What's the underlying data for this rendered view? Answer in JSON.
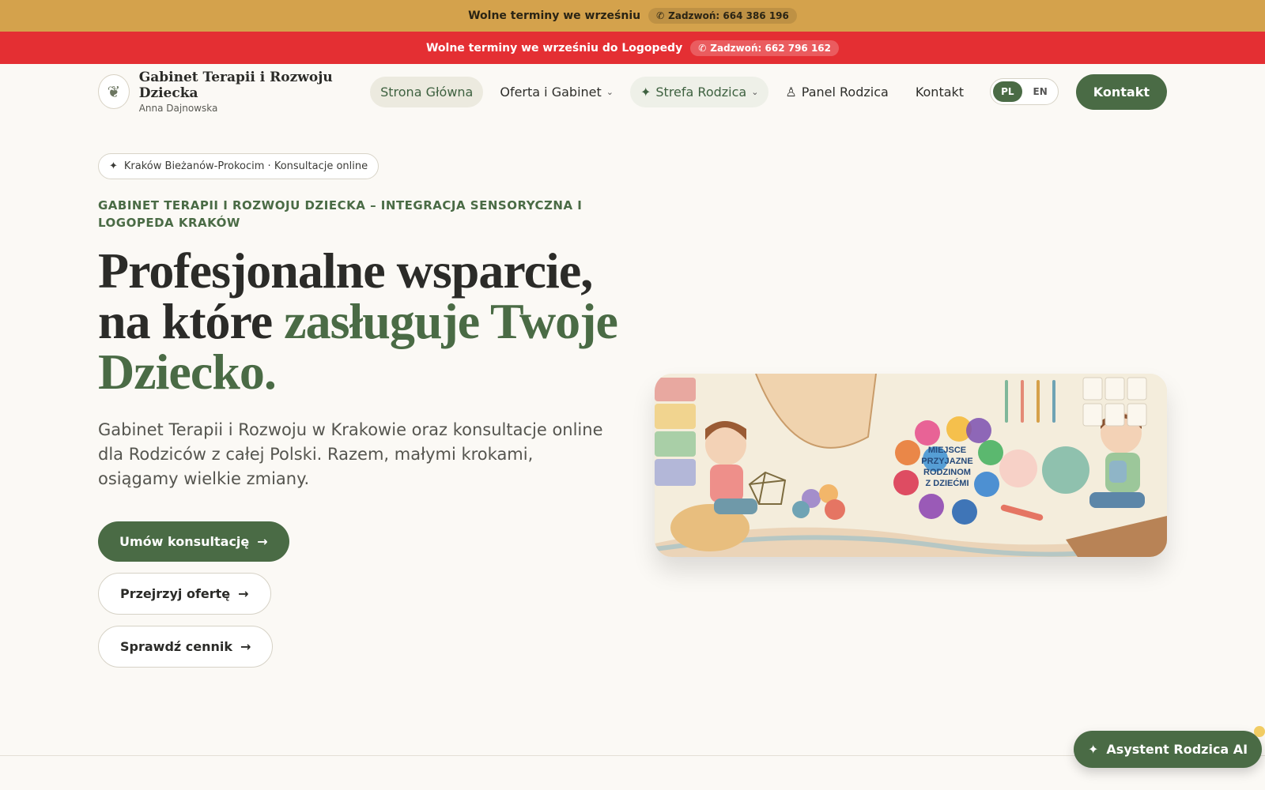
{
  "top_banner": {
    "text": "Wolne terminy we wrześniu",
    "phone": "Zadzwoń: 664 386 196"
  },
  "alert_banner": {
    "text": "Wolne terminy we wrześniu do Logopedy",
    "phone": "Zadzwoń: 662 796 162"
  },
  "brand": {
    "title": "Gabinet Terapii i Rozwoju Dziecka",
    "subtitle": "Anna Dajnowska"
  },
  "nav": {
    "items": [
      {
        "label": "Strona Główna"
      },
      {
        "label": "Oferta i Gabinet"
      },
      {
        "label": "Strefa Rodzica"
      },
      {
        "label": "Panel Rodzica"
      },
      {
        "label": "Kontakt"
      }
    ],
    "lang": [
      "PL",
      "EN"
    ],
    "cta": "Kontakt"
  },
  "hero": {
    "location": "Kraków Bieżanów-Prokocim · Konsultacje online",
    "eyebrow": "GABINET TERAPII I ROZWOJU DZIECKA – INTEGRACJA SENSORYCZNA I LOGOPEDA KRAKÓW",
    "headline_1": "Profesjonalne wsparcie,",
    "headline_2": "na które ",
    "headline_accent": "zasługuje Twoje Dziecko.",
    "lead": "Gabinet Terapii i Rozwoju w Krakowie oraz konsultacje online dla Rodziców z całej Polski. Razem, małymi krokami, osiągamy wielkie zmiany.",
    "buttons": [
      "Umów konsultację",
      "Przejrzyj ofertę",
      "Sprawdź cennik"
    ],
    "illustration_text": [
      "MIEJSCE",
      "PRZYJAZNE",
      "RODZINOM",
      "Z DZIEĆMI"
    ]
  },
  "assistant": {
    "label": "Asystent Rodzica AI"
  }
}
